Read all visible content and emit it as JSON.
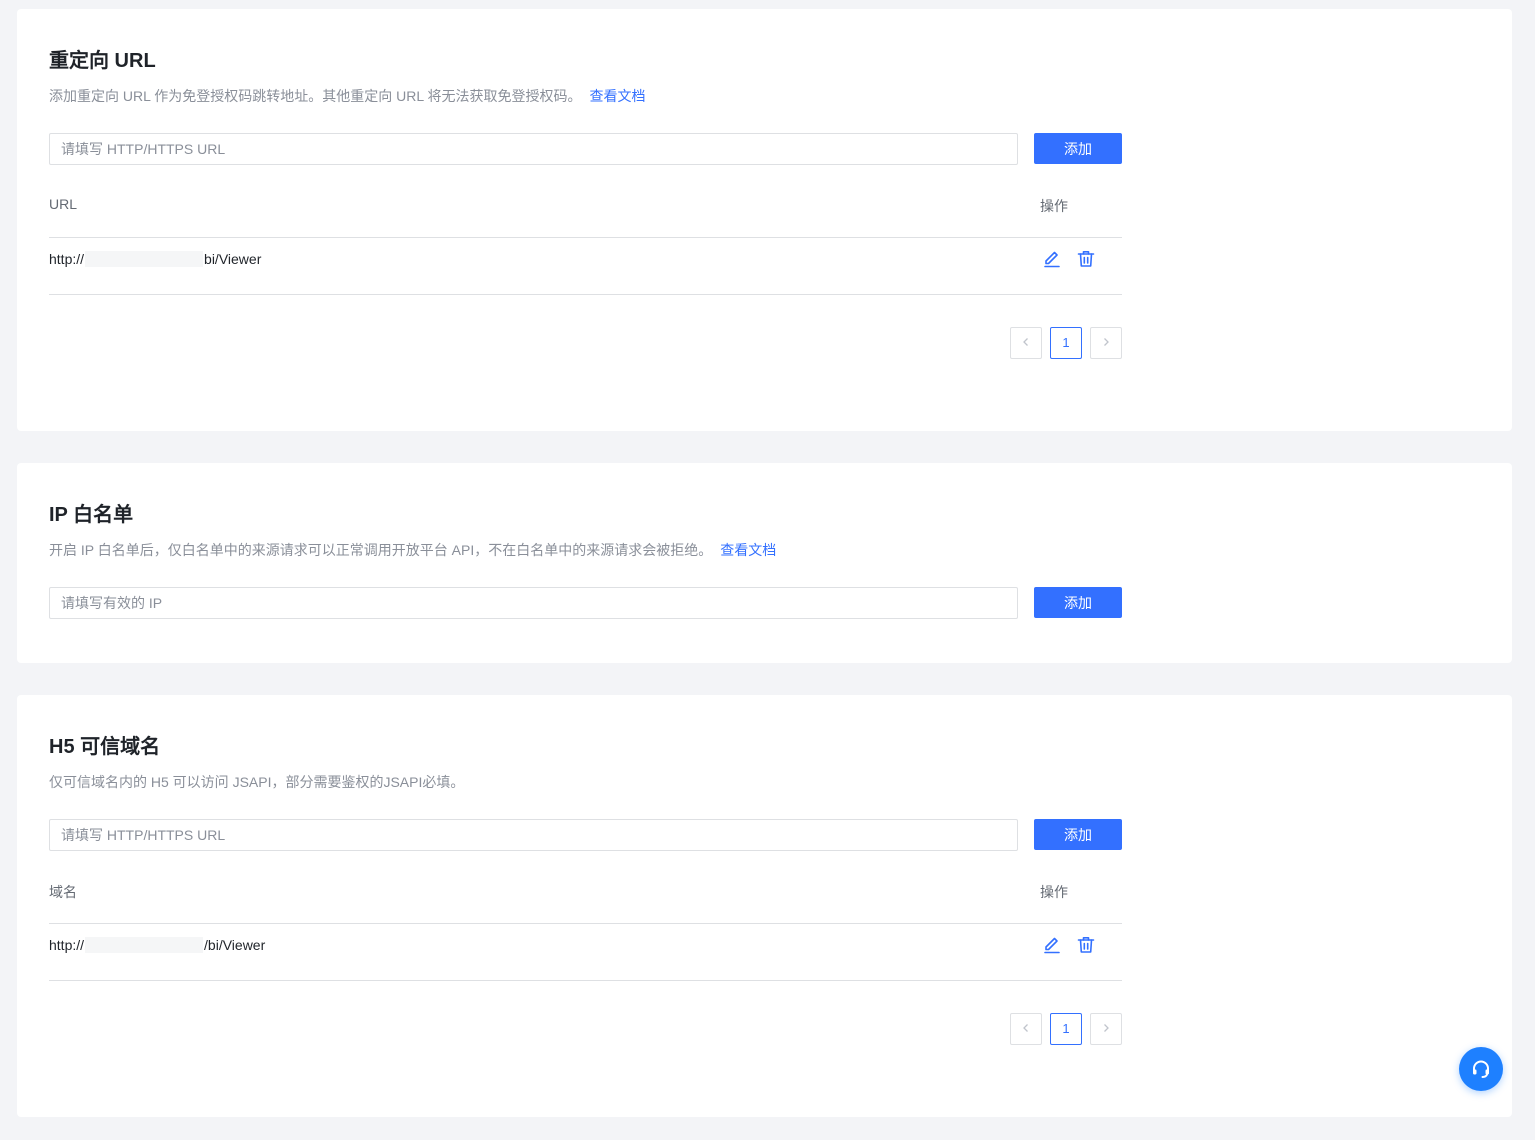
{
  "redirect": {
    "title": "重定向 URL",
    "description": "添加重定向 URL 作为免登授权码跳转地址。其他重定向 URL 将无法获取免登授权码。",
    "doc_link": "查看文档",
    "input_placeholder": "请填写 HTTP/HTTPS URL",
    "add_label": "添加",
    "columns": {
      "main": "URL",
      "op": "操作"
    },
    "rows": [
      {
        "prefix": "http://",
        "suffix": "bi/Viewer"
      }
    ],
    "pager": {
      "current": "1"
    }
  },
  "ip": {
    "title": "IP 白名单",
    "description": "开启 IP 白名单后，仅白名单中的来源请求可以正常调用开放平台 API，不在白名单中的来源请求会被拒绝。",
    "doc_link": "查看文档",
    "input_placeholder": "请填写有效的 IP",
    "add_label": "添加"
  },
  "h5": {
    "title": "H5 可信域名",
    "description": "仅可信域名内的 H5 可以访问 JSAPI，部分需要鉴权的JSAPI必填。",
    "input_placeholder": "请填写 HTTP/HTTPS URL",
    "add_label": "添加",
    "columns": {
      "main": "域名",
      "op": "操作"
    },
    "rows": [
      {
        "prefix": "http://",
        "suffix": "/bi/Viewer"
      }
    ],
    "pager": {
      "current": "1"
    }
  },
  "icons": {
    "edit": "pencil-icon",
    "delete": "trash-icon",
    "prev": "chevron-left-icon",
    "next": "chevron-right-icon",
    "help": "headset-icon"
  },
  "colors": {
    "primary": "#3370ff",
    "background": "#f3f4f7",
    "fab": "#1e80ff"
  }
}
